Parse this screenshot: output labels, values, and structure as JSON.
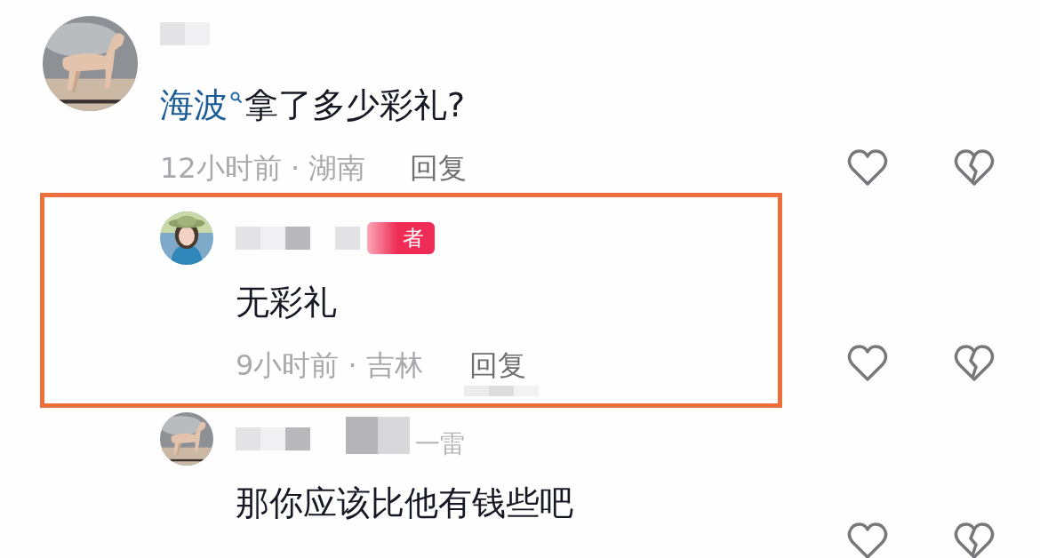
{
  "comments": [
    {
      "kind": "comment",
      "mention": "海波",
      "text": "拿了多少彩礼?",
      "meta": "12小时前 · 湖南",
      "reply": "回复",
      "highlighted": false
    },
    {
      "kind": "reply",
      "badge": "者",
      "text": "无彩礼",
      "meta": "9小时前 · 吉林",
      "reply": "回复",
      "highlighted": true
    },
    {
      "kind": "reply",
      "name_fragment": "一雷",
      "text": "那你应该比他有钱些吧",
      "highlighted": false
    }
  ]
}
